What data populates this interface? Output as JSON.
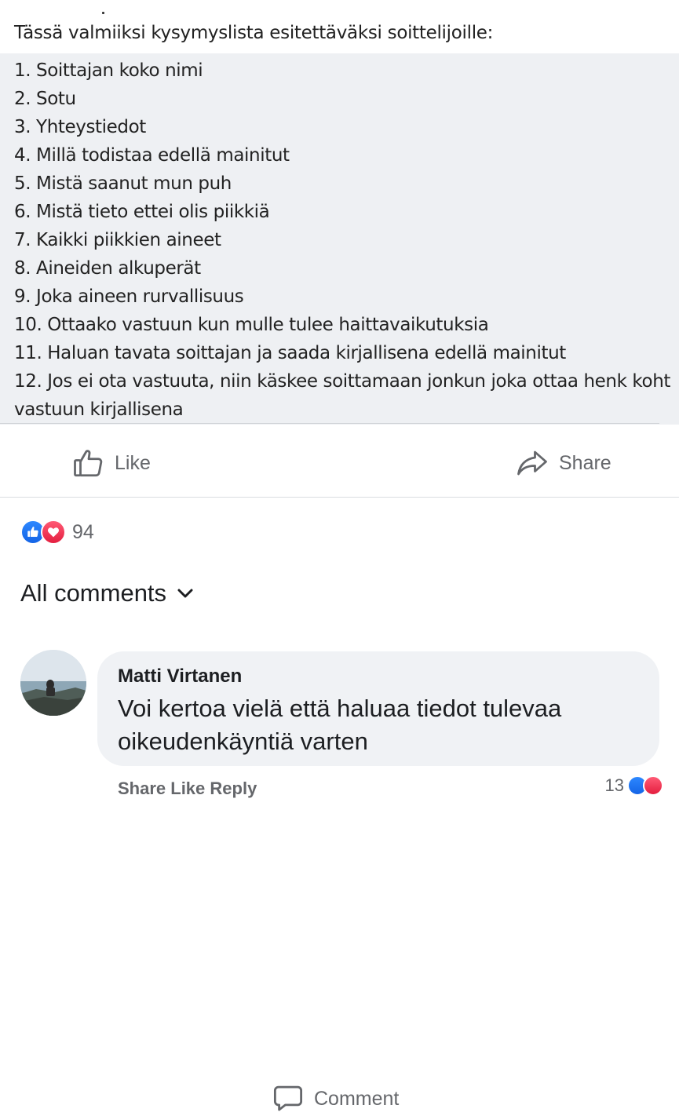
{
  "post": {
    "intro": "Tässä valmiiksi kysymyslista esitettäväksi soittelijoille:",
    "questions": [
      "1. Soittajan koko nimi",
      "2. Sotu",
      "3. Yhteystiedot",
      "4. Millä todistaa edellä mainitut",
      "5. Mistä saanut mun puh",
      "6. Mistä tieto ettei olis piikkiä",
      "7. Kaikki piikkien aineet",
      "8. Aineiden alkuperät",
      "9. Joka aineen rurvallisuus",
      "10. Ottaako vastuun kun mulle tulee haittavaikutuksia",
      "11. Haluan tavata soittajan ja saada kirjallisena edellä mainitut",
      "12. Jos ei ota vastuuta, niin käskee soittamaan jonkun joka ottaa henk koht vastuun kirjallisena"
    ]
  },
  "actions": {
    "like": "Like",
    "comment": "Comment",
    "share": "Share"
  },
  "reactions": {
    "count": "94",
    "icons": [
      "like-icon",
      "love-icon"
    ],
    "colors": {
      "like": "#1877f2",
      "love": "#f33e58"
    }
  },
  "comments_header": "All comments",
  "comments": [
    {
      "author": "Matti Virtanen",
      "text": "Voi kertoa vielä että haluaa tiedot tulevaa oikeudenkäyntiä varten"
    }
  ],
  "comment_meta": {
    "partial_actions": "Share  Like  Reply",
    "reaction_count": "13"
  },
  "colors": {
    "text": "#1c1e21",
    "secondary": "#65676b",
    "bubble": "#f0f2f5"
  }
}
